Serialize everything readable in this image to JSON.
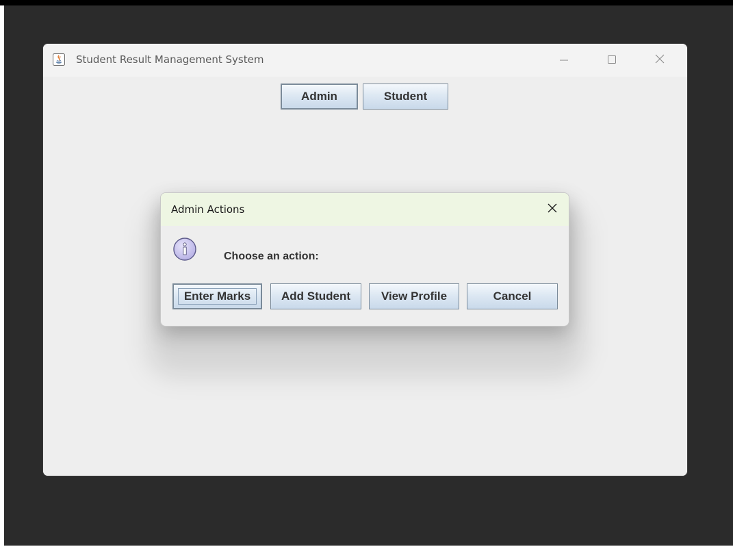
{
  "window": {
    "title": "Student Result Management System",
    "icon": "java-coffee-icon"
  },
  "toolbar": {
    "admin_label": "Admin",
    "student_label": "Student"
  },
  "dialog": {
    "title": "Admin Actions",
    "message": "Choose an action:",
    "icon": "info-icon",
    "buttons": {
      "enter_marks": "Enter Marks",
      "add_student": "Add Student",
      "view_profile": "View Profile",
      "cancel": "Cancel"
    },
    "focused_button": "Enter Marks"
  },
  "colors": {
    "desktop_background": "#2b2b2b",
    "window_background": "#eeeeee",
    "dialog_titlebar": "#eef6e3",
    "button_border": "#7a8a99",
    "button_gradient_top": "#f4f8fc",
    "button_gradient_bottom": "#c9d9ea",
    "info_icon_fill": "#c9c5ee"
  }
}
